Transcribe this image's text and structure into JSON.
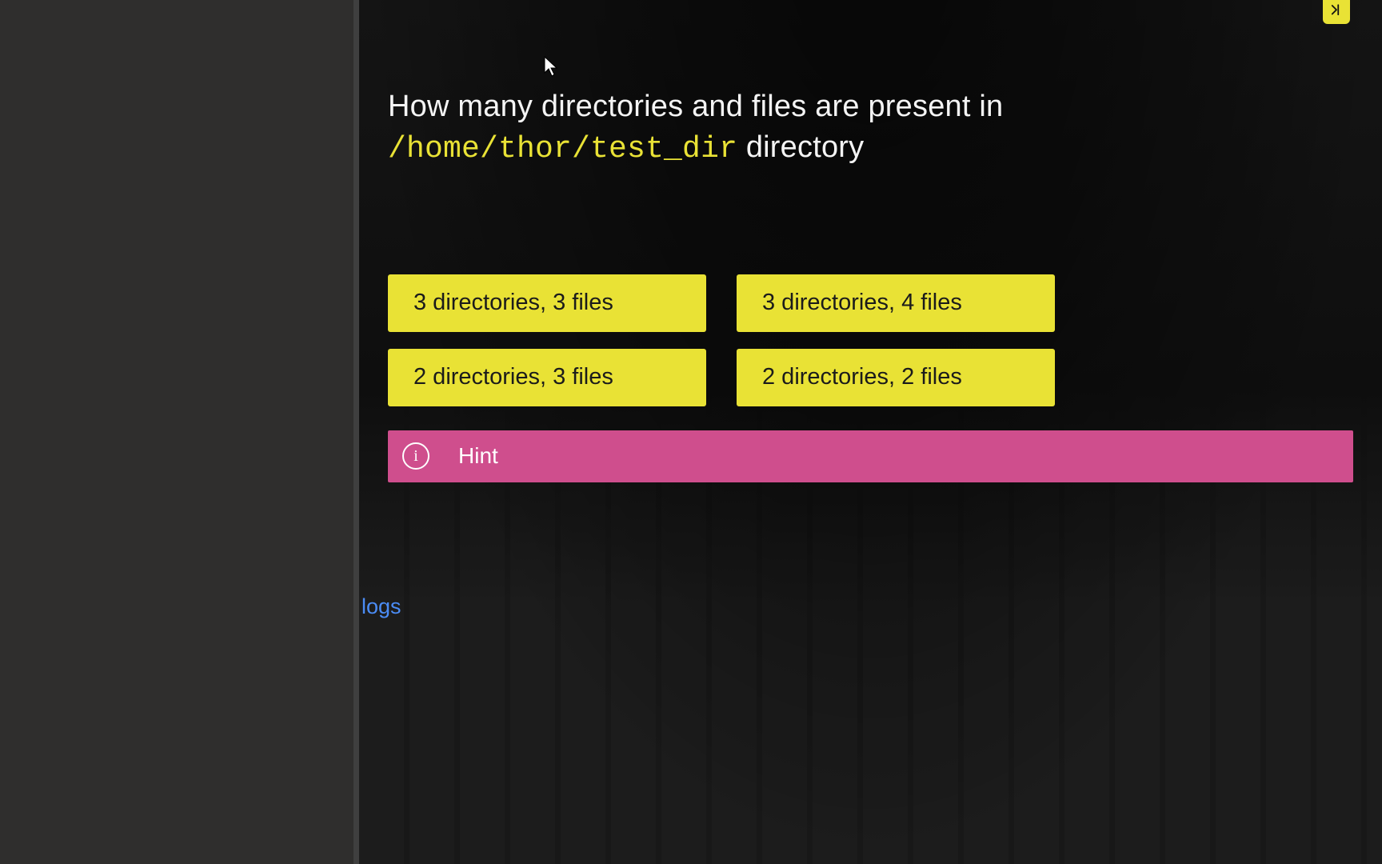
{
  "question": {
    "prefix": "How many directories and files are present in ",
    "code": "/home/thor/test_dir",
    "suffix": " directory"
  },
  "options": [
    "3 directories, 3 files",
    "3 directories, 4 files",
    "2 directories, 3 files",
    "2 directories, 2 files"
  ],
  "hint": {
    "label": "Hint",
    "icon_letter": "i"
  },
  "terminal": {
    "logs_label": "logs"
  }
}
